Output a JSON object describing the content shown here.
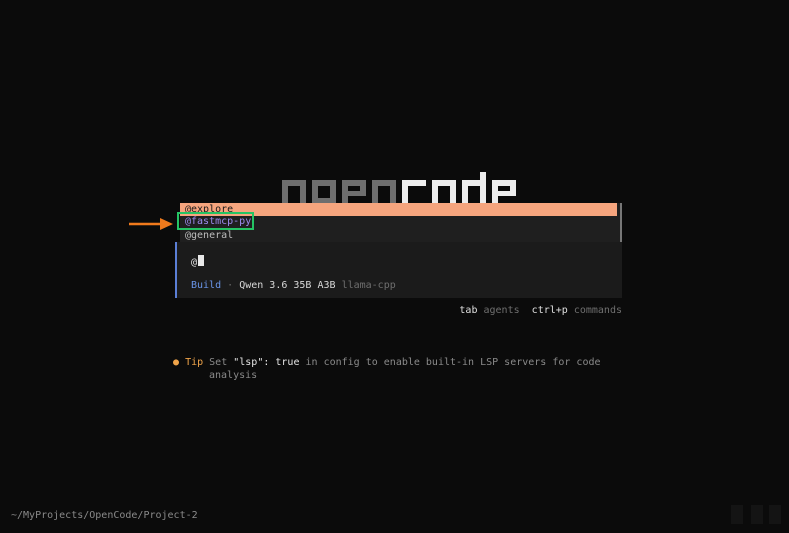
{
  "logo": {
    "text": "opencode",
    "dim_part": "open",
    "bright_part": "code"
  },
  "autocomplete": {
    "items": [
      {
        "label": "@explore",
        "state": "selected"
      },
      {
        "label": "@fastmcp-py",
        "state": "annotated"
      },
      {
        "label": "@general",
        "state": "plain"
      }
    ]
  },
  "prompt": {
    "input_value": "@",
    "agent": "Build",
    "separator": "·",
    "model": "Qwen 3.6 35B A3B",
    "provider": "llama-cpp"
  },
  "hints": [
    {
      "key": "tab",
      "action": "agents"
    },
    {
      "key": "ctrl+p",
      "action": "commands"
    }
  ],
  "tip": {
    "label": "Tip",
    "parts": [
      "Set ",
      "\"lsp\": true",
      " in config to enable built-in LSP servers for code"
    ],
    "line2": "analysis"
  },
  "footer": {
    "path": "~/MyProjects/OpenCode/Project-2"
  },
  "colors": {
    "background": "#0b0b0b",
    "selection": "#f6a57e",
    "highlight_box": "#25c464",
    "arrow": "#f07a1c",
    "agent": "#6a95e8",
    "tip_accent": "#f0a44a"
  },
  "icons": {
    "tip_bullet": "dot-icon",
    "annotation_arrow": "arrow-right-icon"
  }
}
